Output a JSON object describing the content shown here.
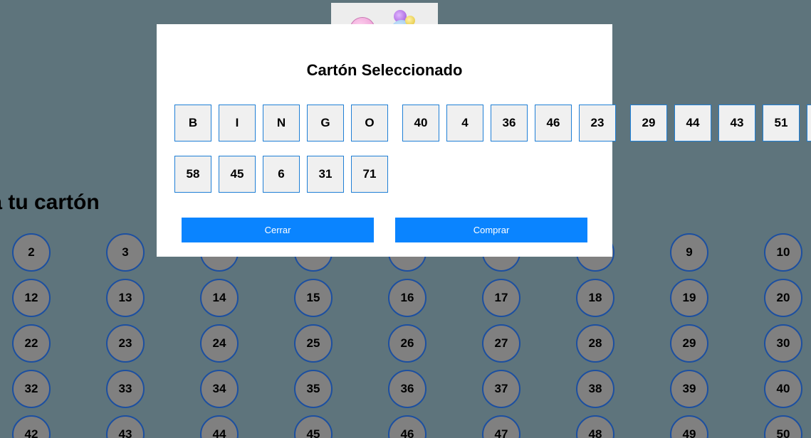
{
  "modal": {
    "title": "Cartón Seleccionado",
    "header_letters": [
      "B",
      "I",
      "N",
      "G",
      "O"
    ],
    "row1_numbers": [
      "40",
      "4",
      "36",
      "46",
      "23"
    ],
    "row2_numbers": [
      "58",
      "45",
      "6",
      "31",
      "71"
    ],
    "overflow_numbers": [
      "29",
      "44",
      "43",
      "51"
    ],
    "close_label": "Cerrar",
    "buy_label": "Comprar"
  },
  "page": {
    "section_title": "Selecciona tu cartón",
    "visible_title_fragment": "na tu cartón"
  },
  "number_rows": [
    [
      "2",
      "3",
      "",
      "",
      "",
      "",
      "",
      "9",
      "10"
    ],
    [
      "12",
      "13",
      "14",
      "15",
      "16",
      "17",
      "18",
      "19",
      "20"
    ],
    [
      "22",
      "23",
      "24",
      "25",
      "26",
      "27",
      "28",
      "29",
      "30"
    ],
    [
      "32",
      "33",
      "34",
      "35",
      "36",
      "37",
      "38",
      "39",
      "40"
    ],
    [
      "42",
      "43",
      "44",
      "45",
      "46",
      "47",
      "48",
      "49",
      "50"
    ]
  ],
  "colors": {
    "background": "#5e747c",
    "ball_fill": "#808080",
    "ball_border": "#1c4fa0",
    "button": "#0a84ff",
    "cell_border": "#1f7fd6"
  }
}
